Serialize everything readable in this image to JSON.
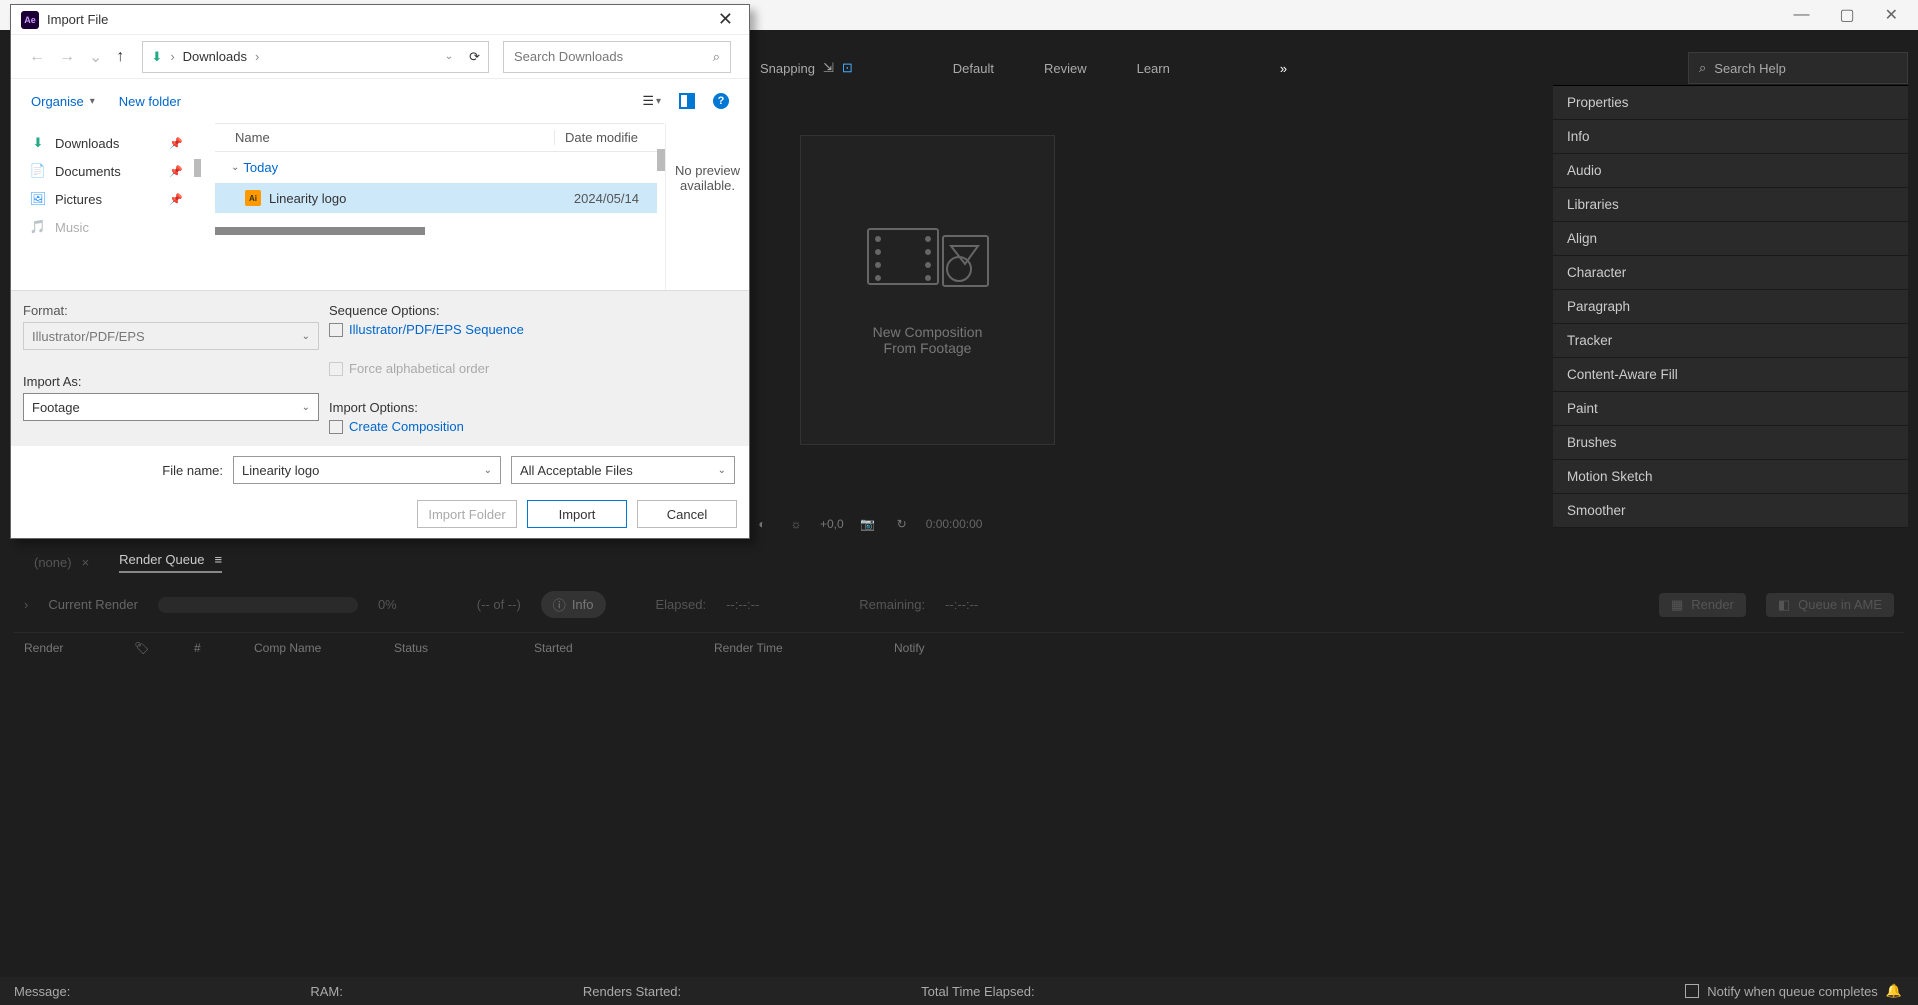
{
  "window": {
    "title": "Import File"
  },
  "nav": {
    "location": "Downloads",
    "search_placeholder": "Search Downloads"
  },
  "toolbar": {
    "organise": "Organise",
    "new_folder": "New folder"
  },
  "sidebar": {
    "items": [
      {
        "label": "Downloads",
        "icon": "download"
      },
      {
        "label": "Documents",
        "icon": "doc"
      },
      {
        "label": "Pictures",
        "icon": "pic"
      },
      {
        "label": "Music",
        "icon": "music"
      }
    ]
  },
  "columns": {
    "name": "Name",
    "date": "Date modifie"
  },
  "file_group": "Today",
  "files": [
    {
      "name": "Linearity logo",
      "date": "2024/05/14"
    }
  ],
  "preview_text": "No preview available.",
  "import_options": {
    "format_label": "Format:",
    "format_value": "Illustrator/PDF/EPS",
    "import_as_label": "Import As:",
    "import_as_value": "Footage",
    "seq_label": "Sequence Options:",
    "seq_check": "Illustrator/PDF/EPS Sequence",
    "force_alpha": "Force alphabetical order",
    "import_opts_label": "Import Options:",
    "create_comp": "Create Composition"
  },
  "file_row": {
    "label": "File name:",
    "value": "Linearity logo",
    "type_value": "All Acceptable Files"
  },
  "buttons": {
    "import_folder": "Import Folder",
    "import": "Import",
    "cancel": "Cancel"
  },
  "app_bar": {
    "snapping": "Snapping",
    "workspaces": [
      "Default",
      "Review",
      "Learn"
    ]
  },
  "search_help_placeholder": "Search Help",
  "panels": [
    "Properties",
    "Info",
    "Audio",
    "Libraries",
    "Align",
    "Character",
    "Paragraph",
    "Tracker",
    "Content-Aware Fill",
    "Paint",
    "Brushes",
    "Motion Sketch",
    "Smoother"
  ],
  "comp_card": {
    "line1": "New Composition",
    "line2": "From Footage"
  },
  "strip": {
    "pos": "+0,0",
    "time": "0:00:00:00"
  },
  "lower": {
    "tab_none": "(none)",
    "tab_rq": "Render Queue",
    "current_render": "Current Render",
    "pct": "0%",
    "of": "(-- of --)",
    "info": "Info",
    "elapsed": "Elapsed:",
    "elapsed_val": "--:--:--",
    "remaining": "Remaining:",
    "remaining_val": "--:--:--",
    "btn_render": "Render",
    "btn_ame": "Queue in AME",
    "cols": {
      "render": "Render",
      "hash": "#",
      "comp": "Comp Name",
      "status": "Status",
      "started": "Started",
      "rtime": "Render Time",
      "notify": "Notify"
    }
  },
  "status": {
    "message": "Message:",
    "ram": "RAM:",
    "renders_started": "Renders Started:",
    "total_time": "Total Time Elapsed:",
    "notify": "Notify when queue completes"
  }
}
